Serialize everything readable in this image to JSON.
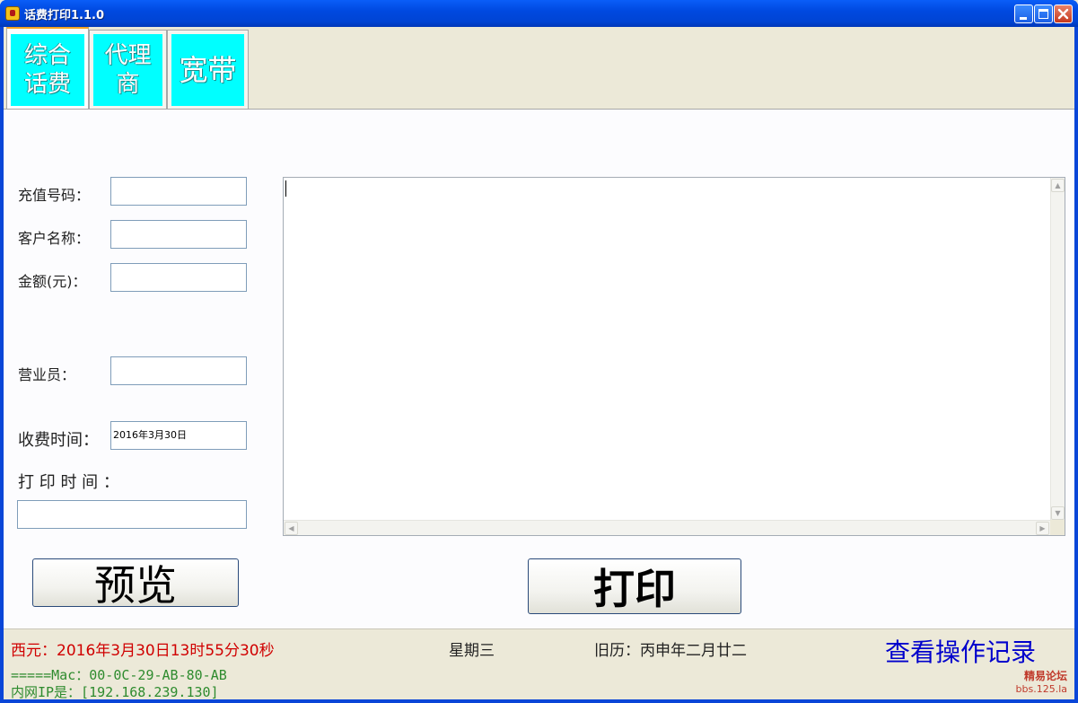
{
  "window": {
    "title": "话费打印1.1.0"
  },
  "tabs": [
    {
      "label": "综合话费",
      "line1": "综合",
      "line2": "话费",
      "active": true
    },
    {
      "label": "代理商",
      "line1": "代理",
      "line2": "商",
      "active": false
    },
    {
      "label": "宽带",
      "line1": "宽带",
      "line2": "",
      "active": false
    }
  ],
  "form": {
    "phone_label": "充值号码：",
    "phone_value": "",
    "customer_label": "客户名称：",
    "customer_value": "",
    "amount_label": "金额(元)：",
    "amount_value": "",
    "clerk_label": "营业员：",
    "clerk_value": "",
    "charge_time_label": "收费时间：",
    "charge_time_value": "2016年3月30日",
    "print_time_label": "打 印 时 间 ：",
    "print_time_value": ""
  },
  "memo": {
    "text": ""
  },
  "buttons": {
    "preview": "预览",
    "print": "打印"
  },
  "status": {
    "datetime": "西元：2016年3月30日13时55分30秒",
    "weekday": "星期三",
    "lunar": "旧历：丙申年二月廿二",
    "view_log": "查看操作记录",
    "mac": "=====Mac：00-0C-29-AB-80-AB",
    "ip": "内网IP是：[192.168.239.130]",
    "watermark_line1": "精易论坛",
    "watermark_line2": "bbs.125.la"
  },
  "colors": {
    "titlebar": "#0a5ef8",
    "tab_image_bg": "#00ffff",
    "datetime_text": "#d00000",
    "view_log_text": "#0000cc",
    "network_text": "#2e8b2e"
  }
}
